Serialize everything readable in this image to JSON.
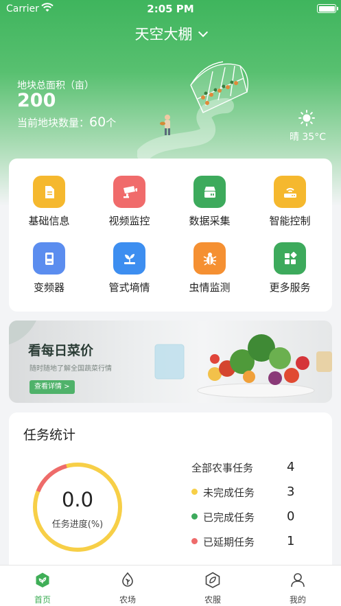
{
  "status_bar": {
    "carrier": "Carrier",
    "time": "2:05 PM"
  },
  "header": {
    "title": "天空大棚"
  },
  "plot": {
    "area_label": "地块总面积（亩）",
    "area_value": "200",
    "count_label": "当前地块数量：",
    "count_value": "60",
    "count_unit": "个"
  },
  "weather": {
    "text": "晴 35°C",
    "icon": "sun-icon"
  },
  "menu": [
    {
      "label": "基础信息",
      "icon": "document-icon",
      "color": "#f5b82e"
    },
    {
      "label": "视频监控",
      "icon": "camera-icon",
      "color": "#f06b6b"
    },
    {
      "label": "数据采集",
      "icon": "server-icon",
      "color": "#3daa5c"
    },
    {
      "label": "智能控制",
      "icon": "router-icon",
      "color": "#f5b82e"
    },
    {
      "label": "变频器",
      "icon": "inverter-icon",
      "color": "#5b8def"
    },
    {
      "label": "管式墒情",
      "icon": "sprout-icon",
      "color": "#3d8ef0"
    },
    {
      "label": "虫情监测",
      "icon": "bug-icon",
      "color": "#f59032"
    },
    {
      "label": "更多服务",
      "icon": "grid-icon",
      "color": "#3daa5c"
    }
  ],
  "banner": {
    "title": "看每日菜价",
    "subtitle": "随时随地了解全国蔬菜行情",
    "button": "查看详情 >"
  },
  "stats": {
    "title": "任务统计",
    "progress_value": "0.0",
    "progress_label": "任务进度(%)",
    "progress_fraction": 0.0,
    "rows": [
      {
        "name": "全部农事任务",
        "value": "4",
        "color": ""
      },
      {
        "name": "未完成任务",
        "value": "3",
        "color": "#f7cf47"
      },
      {
        "name": "已完成任务",
        "value": "0",
        "color": "#3daa5c"
      },
      {
        "name": "已延期任务",
        "value": "1",
        "color": "#ee6b6b"
      }
    ]
  },
  "tabbar": [
    {
      "label": "首页",
      "icon": "home-leaf-icon",
      "active": true
    },
    {
      "label": "农场",
      "icon": "leaf-drop-icon",
      "active": false
    },
    {
      "label": "农服",
      "icon": "service-icon",
      "active": false
    },
    {
      "label": "我的",
      "icon": "user-icon",
      "active": false
    }
  ],
  "colors": {
    "brand": "#3fb55d",
    "active_tab": "#3fae57"
  }
}
